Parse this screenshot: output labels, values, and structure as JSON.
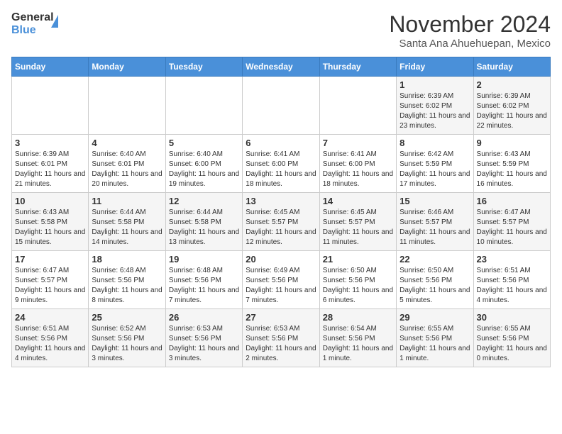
{
  "logo": {
    "line1": "General",
    "line2": "Blue"
  },
  "title": "November 2024",
  "location": "Santa Ana Ahuehuepan, Mexico",
  "days_header": [
    "Sunday",
    "Monday",
    "Tuesday",
    "Wednesday",
    "Thursday",
    "Friday",
    "Saturday"
  ],
  "weeks": [
    [
      {
        "day": "",
        "info": ""
      },
      {
        "day": "",
        "info": ""
      },
      {
        "day": "",
        "info": ""
      },
      {
        "day": "",
        "info": ""
      },
      {
        "day": "",
        "info": ""
      },
      {
        "day": "1",
        "info": "Sunrise: 6:39 AM\nSunset: 6:02 PM\nDaylight: 11 hours and 23 minutes."
      },
      {
        "day": "2",
        "info": "Sunrise: 6:39 AM\nSunset: 6:02 PM\nDaylight: 11 hours and 22 minutes."
      }
    ],
    [
      {
        "day": "3",
        "info": "Sunrise: 6:39 AM\nSunset: 6:01 PM\nDaylight: 11 hours and 21 minutes."
      },
      {
        "day": "4",
        "info": "Sunrise: 6:40 AM\nSunset: 6:01 PM\nDaylight: 11 hours and 20 minutes."
      },
      {
        "day": "5",
        "info": "Sunrise: 6:40 AM\nSunset: 6:00 PM\nDaylight: 11 hours and 19 minutes."
      },
      {
        "day": "6",
        "info": "Sunrise: 6:41 AM\nSunset: 6:00 PM\nDaylight: 11 hours and 18 minutes."
      },
      {
        "day": "7",
        "info": "Sunrise: 6:41 AM\nSunset: 6:00 PM\nDaylight: 11 hours and 18 minutes."
      },
      {
        "day": "8",
        "info": "Sunrise: 6:42 AM\nSunset: 5:59 PM\nDaylight: 11 hours and 17 minutes."
      },
      {
        "day": "9",
        "info": "Sunrise: 6:43 AM\nSunset: 5:59 PM\nDaylight: 11 hours and 16 minutes."
      }
    ],
    [
      {
        "day": "10",
        "info": "Sunrise: 6:43 AM\nSunset: 5:58 PM\nDaylight: 11 hours and 15 minutes."
      },
      {
        "day": "11",
        "info": "Sunrise: 6:44 AM\nSunset: 5:58 PM\nDaylight: 11 hours and 14 minutes."
      },
      {
        "day": "12",
        "info": "Sunrise: 6:44 AM\nSunset: 5:58 PM\nDaylight: 11 hours and 13 minutes."
      },
      {
        "day": "13",
        "info": "Sunrise: 6:45 AM\nSunset: 5:57 PM\nDaylight: 11 hours and 12 minutes."
      },
      {
        "day": "14",
        "info": "Sunrise: 6:45 AM\nSunset: 5:57 PM\nDaylight: 11 hours and 11 minutes."
      },
      {
        "day": "15",
        "info": "Sunrise: 6:46 AM\nSunset: 5:57 PM\nDaylight: 11 hours and 11 minutes."
      },
      {
        "day": "16",
        "info": "Sunrise: 6:47 AM\nSunset: 5:57 PM\nDaylight: 11 hours and 10 minutes."
      }
    ],
    [
      {
        "day": "17",
        "info": "Sunrise: 6:47 AM\nSunset: 5:57 PM\nDaylight: 11 hours and 9 minutes."
      },
      {
        "day": "18",
        "info": "Sunrise: 6:48 AM\nSunset: 5:56 PM\nDaylight: 11 hours and 8 minutes."
      },
      {
        "day": "19",
        "info": "Sunrise: 6:48 AM\nSunset: 5:56 PM\nDaylight: 11 hours and 7 minutes."
      },
      {
        "day": "20",
        "info": "Sunrise: 6:49 AM\nSunset: 5:56 PM\nDaylight: 11 hours and 7 minutes."
      },
      {
        "day": "21",
        "info": "Sunrise: 6:50 AM\nSunset: 5:56 PM\nDaylight: 11 hours and 6 minutes."
      },
      {
        "day": "22",
        "info": "Sunrise: 6:50 AM\nSunset: 5:56 PM\nDaylight: 11 hours and 5 minutes."
      },
      {
        "day": "23",
        "info": "Sunrise: 6:51 AM\nSunset: 5:56 PM\nDaylight: 11 hours and 4 minutes."
      }
    ],
    [
      {
        "day": "24",
        "info": "Sunrise: 6:51 AM\nSunset: 5:56 PM\nDaylight: 11 hours and 4 minutes."
      },
      {
        "day": "25",
        "info": "Sunrise: 6:52 AM\nSunset: 5:56 PM\nDaylight: 11 hours and 3 minutes."
      },
      {
        "day": "26",
        "info": "Sunrise: 6:53 AM\nSunset: 5:56 PM\nDaylight: 11 hours and 3 minutes."
      },
      {
        "day": "27",
        "info": "Sunrise: 6:53 AM\nSunset: 5:56 PM\nDaylight: 11 hours and 2 minutes."
      },
      {
        "day": "28",
        "info": "Sunrise: 6:54 AM\nSunset: 5:56 PM\nDaylight: 11 hours and 1 minute."
      },
      {
        "day": "29",
        "info": "Sunrise: 6:55 AM\nSunset: 5:56 PM\nDaylight: 11 hours and 1 minute."
      },
      {
        "day": "30",
        "info": "Sunrise: 6:55 AM\nSunset: 5:56 PM\nDaylight: 11 hours and 0 minutes."
      }
    ]
  ]
}
